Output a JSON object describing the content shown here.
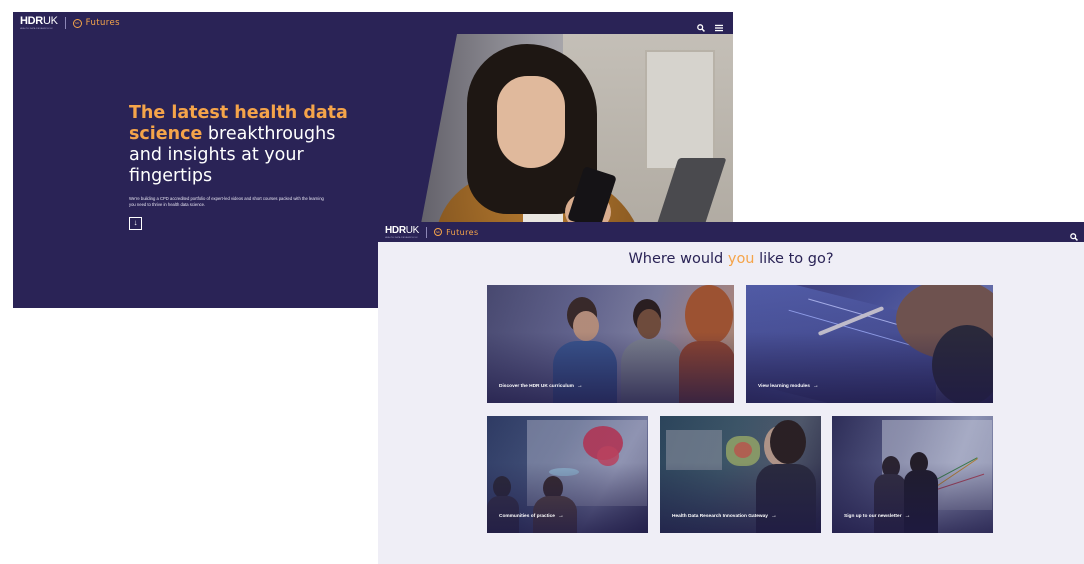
{
  "brand": {
    "hdr": "HDR",
    "uk": "UK",
    "tagline": "HEALTH DATA RESEARCH UK",
    "futures_badge": "hdr",
    "futures": "Futures"
  },
  "icons": {
    "search": "search-icon",
    "menu": "hamburger-menu-icon",
    "down_arrow": "arrow-down-icon",
    "tile_arrow": "arrow-right-icon"
  },
  "colors": {
    "navy": "#2a2356",
    "orange": "#f5a44a",
    "page_bg": "#efeef6"
  },
  "hero": {
    "title_orange_1": "The latest health data",
    "title_orange_2": "science",
    "title_white_1": " breakthroughs",
    "title_white_2": "and insights at your",
    "title_white_3": "fingertips",
    "paragraph": "We're building a CPD accredited portfolio of expert-led videos and short courses packed with the learning you need to thrive in health data science.",
    "down_button": "↓"
  },
  "navigation": {
    "heading_before": "Where would ",
    "heading_highlight": "you",
    "heading_after": " like to go?",
    "tiles": [
      {
        "label": "Discover the HDR UK curriculum",
        "arrow": "→"
      },
      {
        "label": "View learning modules",
        "arrow": "→"
      },
      {
        "label": "Communities of practice",
        "arrow": "→"
      },
      {
        "label": "Health Data Research Innovation Gateway",
        "arrow": "→"
      },
      {
        "label": "Sign up to our newsletter",
        "arrow": "→"
      }
    ]
  }
}
